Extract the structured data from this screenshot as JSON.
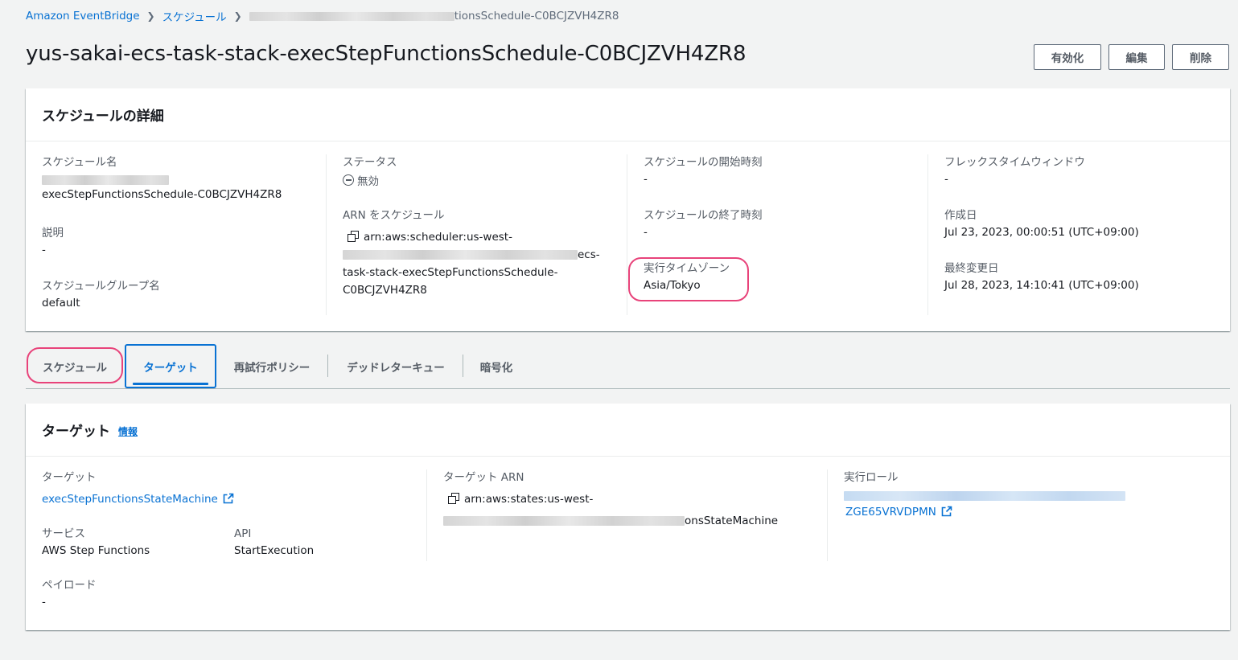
{
  "breadcrumb": {
    "root": "Amazon EventBridge",
    "level2": "スケジュール",
    "current_tail": "tionsSchedule-C0BCJZVH4ZR8"
  },
  "page": {
    "title": "yus-sakai-ecs-task-stack-execStepFunctionsSchedule-C0BCJZVH4ZR8"
  },
  "actions": {
    "enable": "有効化",
    "edit": "編集",
    "delete": "削除"
  },
  "details": {
    "header": "スケジュールの詳細",
    "schedule_name_label": "スケジュール名",
    "schedule_name_value": "execStepFunctionsSchedule-C0BCJZVH4ZR8",
    "description_label": "説明",
    "description_value": "-",
    "group_label": "スケジュールグループ名",
    "group_value": "default",
    "status_label": "ステータス",
    "status_value": "無効",
    "arn_label": "ARN をスケジュール",
    "arn_line1": "arn:aws:scheduler:us-west-",
    "arn_line2_tail": "ecs-",
    "arn_line3": "task-stack-execStepFunctionsSchedule-",
    "arn_line4": "C0BCJZVH4ZR8",
    "start_label": "スケジュールの開始時刻",
    "start_value": "-",
    "end_label": "スケジュールの終了時刻",
    "end_value": "-",
    "timezone_label": "実行タイムゾーン",
    "timezone_value": "Asia/Tokyo",
    "flex_label": "フレックスタイムウィンドウ",
    "flex_value": "-",
    "created_label": "作成日",
    "created_value": "Jul 23, 2023, 00:00:51 (UTC+09:00)",
    "modified_label": "最終変更日",
    "modified_value": "Jul 28, 2023, 14:10:41 (UTC+09:00)"
  },
  "tabs": [
    {
      "label": "スケジュール"
    },
    {
      "label": "ターゲット"
    },
    {
      "label": "再試行ポリシー"
    },
    {
      "label": "デッドレターキュー"
    },
    {
      "label": "暗号化"
    }
  ],
  "target": {
    "header": "ターゲット",
    "info": "情報",
    "target_label": "ターゲット",
    "target_value": "execStepFunctionsStateMachine",
    "service_label": "サービス",
    "service_value": "AWS Step Functions",
    "api_label": "API",
    "api_value": "StartExecution",
    "payload_label": "ペイロード",
    "payload_value": "-",
    "arn_label": "ターゲット ARN",
    "arn_line1": "arn:aws:states:us-west-",
    "arn_line2_tail": "onsStateMachine",
    "role_label": "実行ロール",
    "role_value_tail": "ZGE65VRVDPMN"
  },
  "colors": {
    "link": "#0972d3",
    "highlight": "#e8437a",
    "background": "#f2f3f3"
  }
}
